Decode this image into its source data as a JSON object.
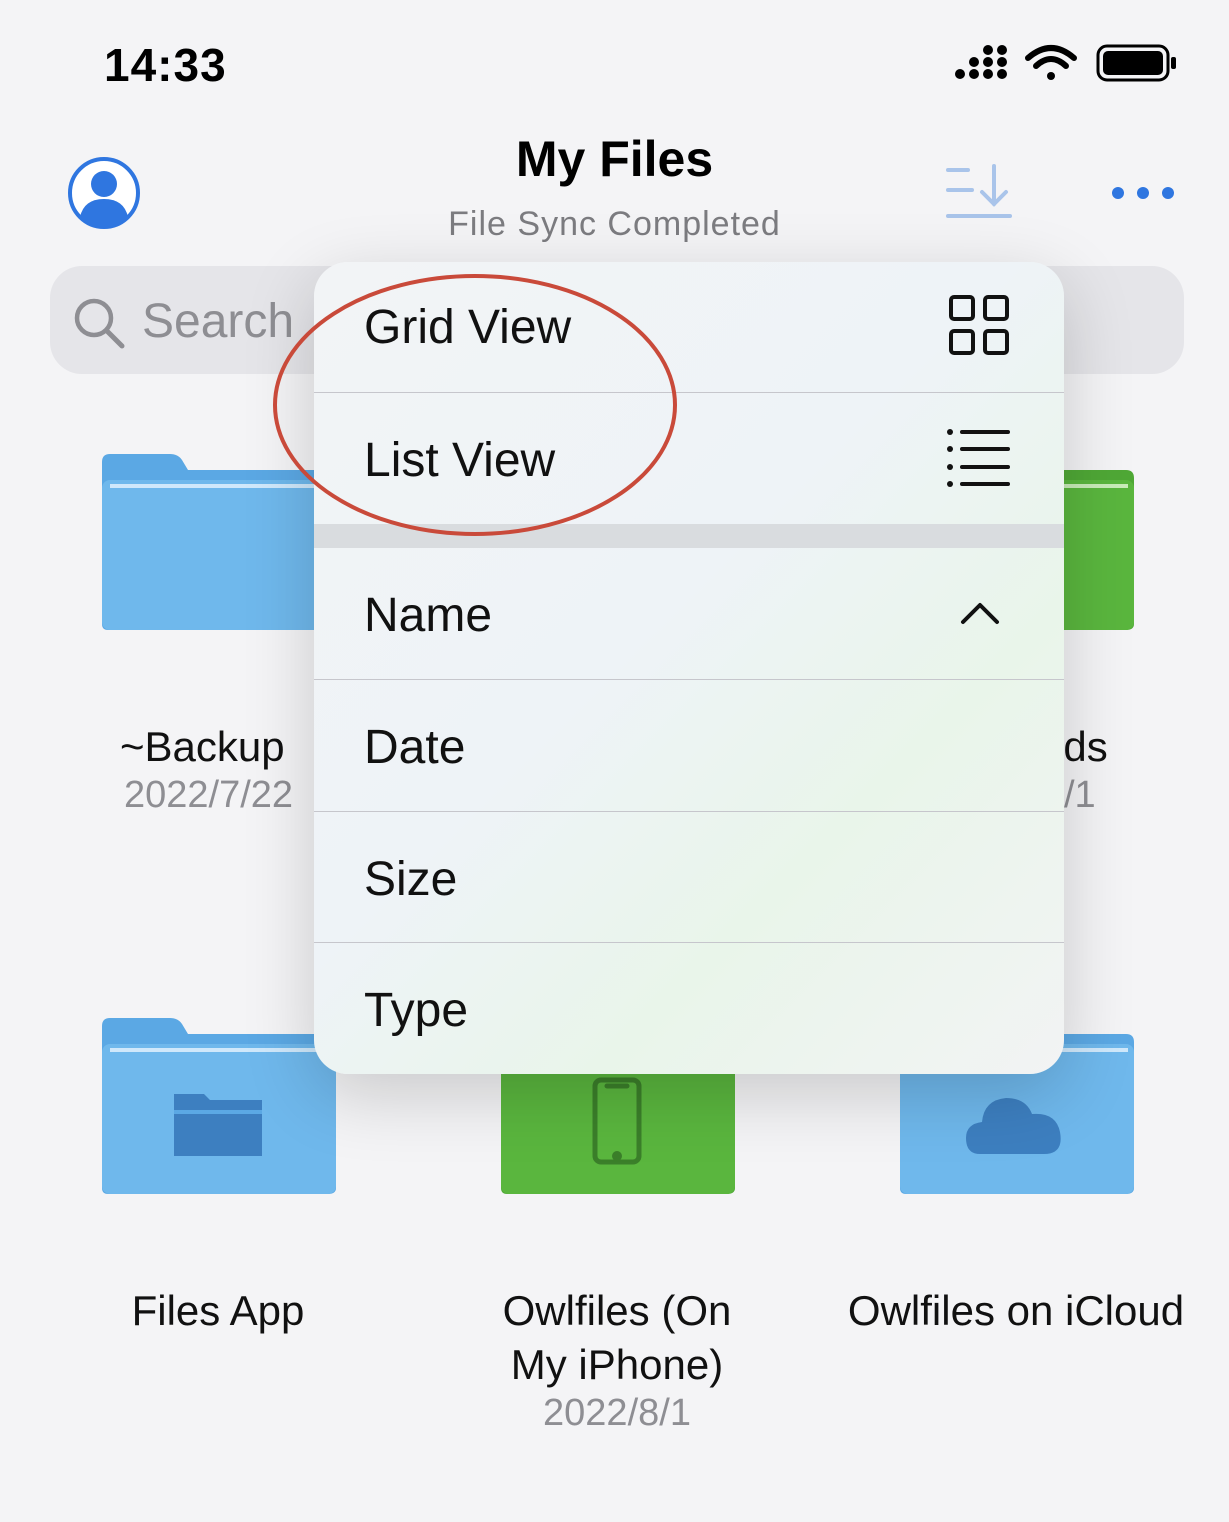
{
  "status_bar": {
    "time": "14:33"
  },
  "header": {
    "title": "My Files",
    "subtitle": "File Sync Completed"
  },
  "search": {
    "placeholder": "Search"
  },
  "folders": [
    {
      "name": "~Backup",
      "date": "2022/7/22",
      "color": "blue"
    },
    {
      "name": "ads",
      "date": "/1",
      "color": "green"
    },
    {
      "name": "Files App",
      "date": "",
      "color": "blue"
    },
    {
      "name": "Owlfiles (On",
      "name2": "My iPhone)",
      "date": "2022/8/1",
      "color": "green"
    },
    {
      "name": "Owlfiles on iCloud",
      "date": "",
      "color": "blue"
    }
  ],
  "menu": {
    "view_options": [
      {
        "label": "Grid View",
        "icon": "grid-icon"
      },
      {
        "label": "List View",
        "icon": "list-icon"
      }
    ],
    "sort_options": [
      {
        "label": "Name",
        "icon": "chevron-up-icon",
        "selected": true
      },
      {
        "label": "Date"
      },
      {
        "label": "Size"
      },
      {
        "label": "Type"
      }
    ]
  },
  "colors": {
    "accent": "#2f76e0",
    "annotation": "#c94a3a",
    "folder_blue": "#6fb3e8",
    "folder_green": "#5ab63e"
  }
}
